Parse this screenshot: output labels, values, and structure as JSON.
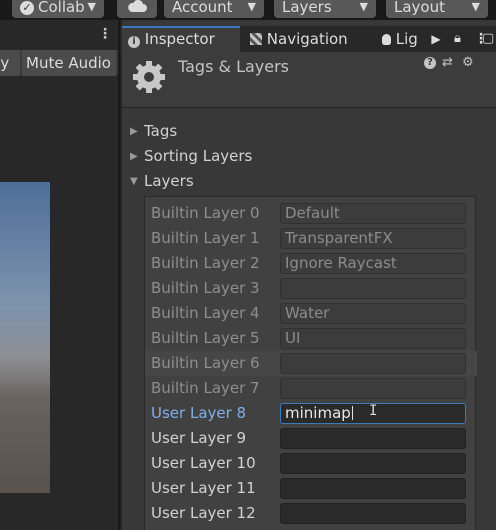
{
  "toolbar": {
    "collab_label": "Collab",
    "cloud_icon": "cloud-icon",
    "account_label": "Account",
    "layers_label": "Layers",
    "layout_label": "Layout",
    "dropdown_caret": "▼"
  },
  "left_panel": {
    "play_label": "Play",
    "mute_audio_label": "Mute Audio"
  },
  "tabs": {
    "inspector": "Inspector",
    "navigation": "Navigation",
    "lighting": "Lig"
  },
  "inspector_header": {
    "title": "Tags & Layers"
  },
  "foldouts": {
    "tags": "Tags",
    "sorting_layers": "Sorting Layers",
    "layers": "Layers"
  },
  "layers": [
    {
      "label": "Builtin Layer 0",
      "value": "Default"
    },
    {
      "label": "Builtin Layer 1",
      "value": "TransparentFX"
    },
    {
      "label": "Builtin Layer 2",
      "value": "Ignore Raycast"
    },
    {
      "label": "Builtin Layer 3",
      "value": ""
    },
    {
      "label": "Builtin Layer 4",
      "value": "Water"
    },
    {
      "label": "Builtin Layer 5",
      "value": "UI"
    },
    {
      "label": "Builtin Layer 6",
      "value": ""
    },
    {
      "label": "Builtin Layer 7",
      "value": ""
    },
    {
      "label": "User Layer 8",
      "value": "minimap"
    },
    {
      "label": "User Layer 9",
      "value": ""
    },
    {
      "label": "User Layer 10",
      "value": ""
    },
    {
      "label": "User Layer 11",
      "value": ""
    },
    {
      "label": "User Layer 12",
      "value": ""
    }
  ],
  "colors": {
    "focus_accent": "#3a79bb",
    "focused_label": "#7fb0ec"
  }
}
